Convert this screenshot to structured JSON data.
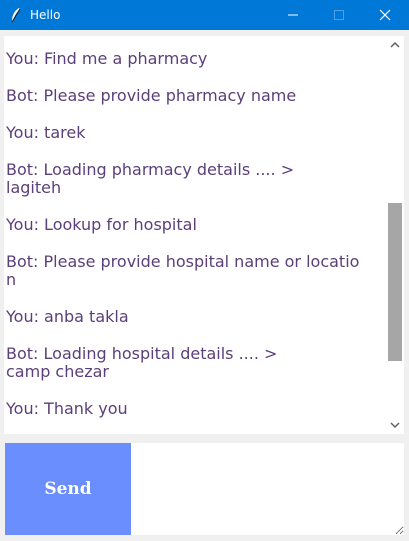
{
  "window": {
    "title": "Hello",
    "accent_color": "#0078d7",
    "icons": {
      "app": "feather-icon",
      "minimize": "minimize-icon",
      "maximize": "maximize-icon",
      "close": "close-icon"
    }
  },
  "chat": {
    "text_color": "#5b3f7a",
    "messages": [
      "You: Find me a pharmacy",
      "Bot: Please provide pharmacy name",
      "You: tarek",
      "Bot: Loading pharmacy details .... >\nlagiteh",
      "You: Lookup for hospital",
      "Bot: Please provide hospital name or locatio\nn",
      "You: anba takla",
      "Bot: Loading hospital details .... >\ncamp chezar",
      "You: Thank you"
    ]
  },
  "scrollbar": {
    "up_icon": "chevron-up-icon",
    "down_icon": "chevron-down-icon"
  },
  "composer": {
    "send_label": "Send",
    "send_color": "#6b8eff",
    "input_value": ""
  }
}
